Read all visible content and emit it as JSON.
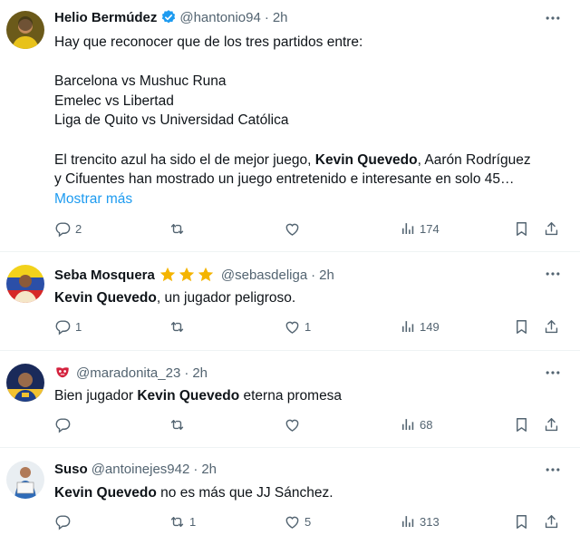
{
  "tweets": [
    {
      "name": "Helio Bermúdez",
      "handle": "@hantonio94",
      "time": "2h",
      "lines": {
        "l1": "Hay que reconocer que de los tres partidos entre:",
        "l2": "Barcelona vs Mushuc Runa",
        "l3": "Emelec vs Libertad",
        "l4": "Liga de Quito vs Universidad Católica",
        "l5a": "El trencito azul ha sido el de mejor juego, ",
        "l5b": "Kevin Quevedo",
        "l5c": ", Aarón Rodríguez",
        "l6": "y Cifuentes han mostrado un juego entretenido e interesante en solo 45…"
      },
      "show_more": "Mostrar más",
      "replies": "2",
      "retweets": "",
      "likes": "",
      "views": "174"
    },
    {
      "name": "Seba Mosquera",
      "handle": "@sebasdeliga",
      "time": "2h",
      "bold": "Kevin Quevedo",
      "rest": ", un jugador peligroso.",
      "replies": "1",
      "retweets": "",
      "likes": "1",
      "views": "149"
    },
    {
      "name": "",
      "handle": "@maradonita_23",
      "time": "2h",
      "pre": "Bien jugador ",
      "bold": "Kevin Quevedo",
      "rest": " eterna promesa",
      "replies": "",
      "retweets": "",
      "likes": "",
      "views": "68"
    },
    {
      "name": "Suso",
      "handle": "@antoinejes942",
      "time": "2h",
      "bold": "Kevin Quevedo",
      "rest": " no es más que JJ Sánchez.",
      "replies": "",
      "retweets": "1",
      "likes": "5",
      "views": "313"
    }
  ],
  "separator": "·",
  "colors": {
    "accent": "#1d9bf0",
    "muted": "#536471",
    "text": "#0f1419",
    "star": "#f4b400"
  }
}
